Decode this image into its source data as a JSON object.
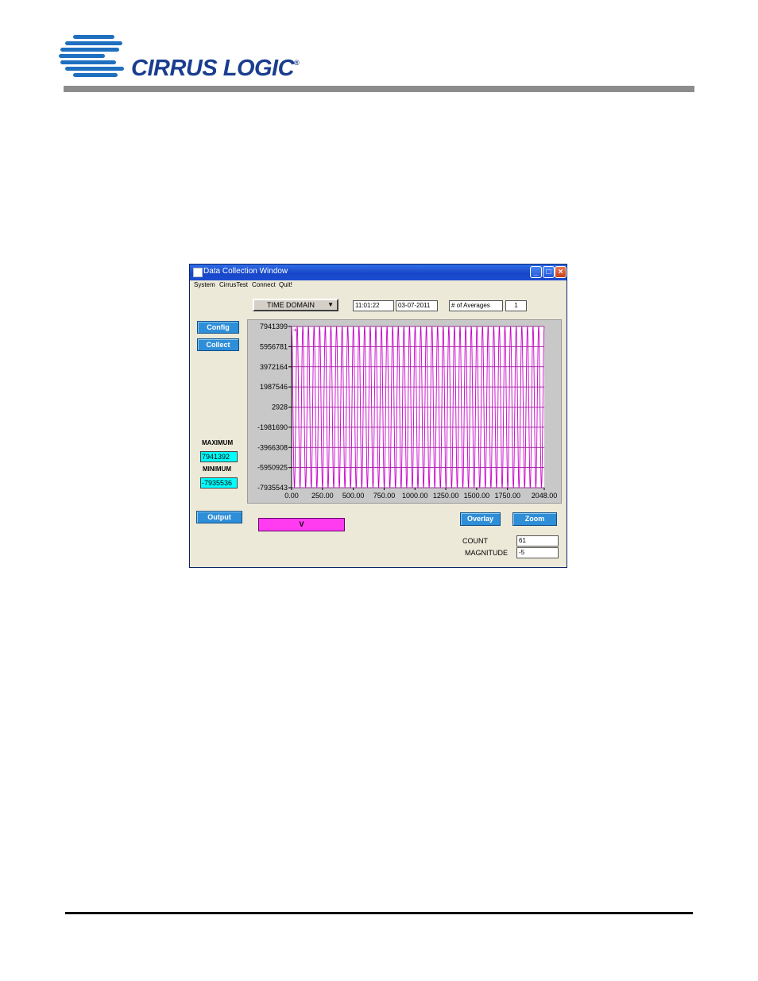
{
  "brand": {
    "name": "CIRRUS LOGIC",
    "mark": "®"
  },
  "window": {
    "title": "Data Collection Window",
    "controls": {
      "minimize": "_",
      "maximize": "□",
      "close": "×"
    },
    "menu": [
      "System",
      "CirrusTest",
      "Connect",
      "Quit!"
    ]
  },
  "toolbar": {
    "domain": "TIME DOMAIN",
    "time": "11:01:22",
    "date": "03-07-2011",
    "averages_label": "# of Averages",
    "averages_value": "1"
  },
  "buttons": {
    "config": "Config",
    "collect": "Collect",
    "output": "Output",
    "overlay": "Overlay",
    "zoom": "Zoom"
  },
  "stats": {
    "maximum_label": "MAXIMUM",
    "maximum_value": "7941392",
    "minimum_label": "MINIMUM",
    "minimum_value": "-7935536"
  },
  "channel_indicator": "V",
  "readouts": {
    "count_label": "COUNT",
    "count_value": "61",
    "magnitude_label": "MAGNITUDE",
    "magnitude_value": "-5"
  },
  "colors": {
    "trace": "#c800c8",
    "gridline": "#800080",
    "plot_bg": "#ffffff",
    "indicator": "#ff3cf0",
    "value_bg": "#00ffff"
  },
  "chart_data": {
    "type": "line",
    "xlim": [
      0,
      2048
    ],
    "ylim": [
      -7935543,
      7941399
    ],
    "x_ticks": [
      "0.00",
      "250.00",
      "500.00",
      "750.00",
      "1000.00",
      "1250.00",
      "1500.00",
      "1750.00",
      "2048.00"
    ],
    "y_ticks": [
      "7941399",
      "5956781",
      "3972164",
      "1987546",
      "2928",
      "-1981690",
      "-3966308",
      "-5950925",
      "-7935543"
    ],
    "series": [
      {
        "waveform": "sine",
        "cycles": 45,
        "amplitude_max": 7941392,
        "amplitude_min": -7935536,
        "samples": 2048
      }
    ]
  }
}
